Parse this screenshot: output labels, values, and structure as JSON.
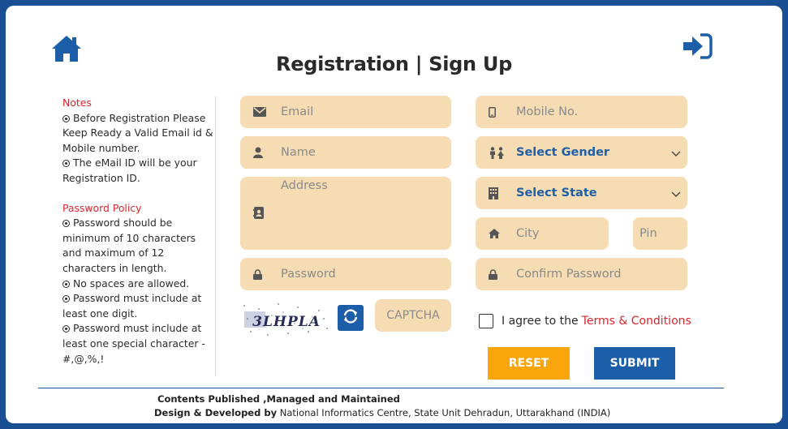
{
  "header": {
    "title": "Registration | Sign Up",
    "home_icon": "home-icon",
    "signin_icon": "sign-in-icon",
    "icon_color": "#1c5ea8"
  },
  "notes": {
    "heading": "Notes",
    "items": [
      "Before Registration Please Keep Ready a Valid Email id & Mobile number.",
      "The eMail ID will be your Registration ID."
    ],
    "password_heading": "Password Policy",
    "password_items": [
      "Password should be minimum of 10 characters and maximum of 12 characters in length.",
      "No spaces are allowed.",
      "Password must include at least one digit.",
      "Password must include at least one special character - #,@,%,!"
    ]
  },
  "form": {
    "email_placeholder": "Email",
    "name_placeholder": "Name",
    "address_placeholder": "Address",
    "password_placeholder": "Password",
    "mobile_placeholder": "Mobile No.",
    "gender_selected": "Select Gender",
    "state_selected": "Select State",
    "city_placeholder": "City",
    "pin_placeholder": "Pin",
    "confirm_password_placeholder": "Confirm Password",
    "captcha_text": "3LHPLA",
    "captcha_placeholder": "CAPTCHA",
    "agree_text": "I agree to the",
    "terms_link": "Terms & Conditions",
    "reset_label": "RESET",
    "submit_label": "SUBMIT"
  },
  "footer": {
    "line1": "Contents Published ,Managed and Maintained",
    "line2_bold": "Design & Developed by",
    "line2_rest": "National Informatics Centre, State Unit Dehradun, Uttarakhand (INDIA)"
  },
  "colors": {
    "field_bg": "#f5dcb3",
    "accent_blue": "#1c5ea8",
    "reset_orange": "#f9a50b",
    "red": "#d9262e",
    "page_border": "#1b4f93"
  }
}
